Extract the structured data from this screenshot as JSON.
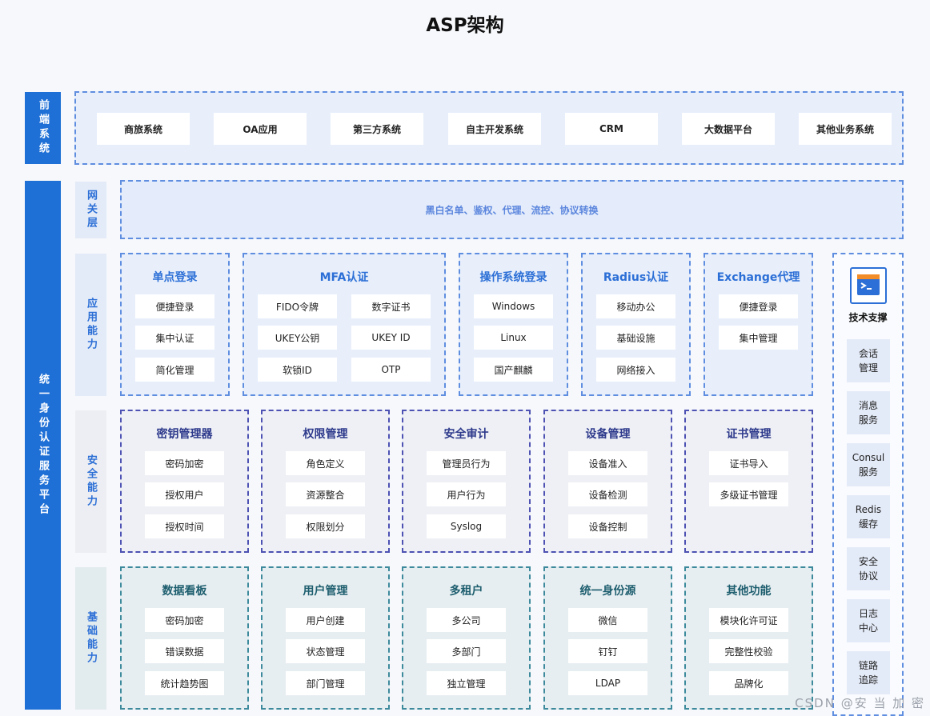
{
  "title": "ASP架构",
  "sidebar": {
    "front_label": "前端系统",
    "platform_label": "统一身份认证服务平台"
  },
  "front_systems": [
    "商旅系统",
    "OA应用",
    "第三方系统",
    "自主开发系统",
    "CRM",
    "大数据平台",
    "其他业务系统"
  ],
  "layers": {
    "gateway": "网关层",
    "application": "应用能力",
    "security": "安全能力",
    "foundation": "基础能力"
  },
  "gateway_text": "黑白名单、鉴权、代理、流控、协议转换",
  "application_modules": [
    {
      "title": "单点登录",
      "items": [
        "便捷登录",
        "集中认证",
        "简化管理"
      ]
    },
    {
      "title": "MFA认证",
      "items": [
        "FIDO令牌",
        "数字证书",
        "UKEY公钥",
        "UKEY ID",
        "软锁ID",
        "OTP"
      ]
    },
    {
      "title": "操作系统登录",
      "items": [
        "Windows",
        "Linux",
        "国产麒麟"
      ]
    },
    {
      "title": "Radius认证",
      "items": [
        "移动办公",
        "基础设施",
        "网络接入"
      ]
    },
    {
      "title": "Exchange代理",
      "items": [
        "便捷登录",
        "集中管理"
      ]
    }
  ],
  "security_modules": [
    {
      "title": "密钥管理器",
      "items": [
        "密码加密",
        "授权用户",
        "授权时间"
      ]
    },
    {
      "title": "权限管理",
      "items": [
        "角色定义",
        "资源整合",
        "权限划分"
      ]
    },
    {
      "title": "安全审计",
      "items": [
        "管理员行为",
        "用户行为",
        "Syslog"
      ]
    },
    {
      "title": "设备管理",
      "items": [
        "设备准入",
        "设备检测",
        "设备控制"
      ]
    },
    {
      "title": "证书管理",
      "items": [
        "证书导入",
        "多级证书管理"
      ]
    }
  ],
  "foundation_modules": [
    {
      "title": "数据看板",
      "items": [
        "密码加密",
        "错误数据",
        "统计趋势图"
      ]
    },
    {
      "title": "用户管理",
      "items": [
        "用户创建",
        "状态管理",
        "部门管理"
      ]
    },
    {
      "title": "多租户",
      "items": [
        "多公司",
        "多部门",
        "独立管理"
      ]
    },
    {
      "title": "统一身份源",
      "items": [
        "微信",
        "钉钉",
        "LDAP"
      ]
    },
    {
      "title": "其他功能",
      "items": [
        "模块化许可证",
        "完整性校验",
        "品牌化"
      ]
    }
  ],
  "tech_support": {
    "title": "技术支撑",
    "icon": "terminal-icon",
    "items": [
      "会话\n管理",
      "消息\n服务",
      "Consul\n服务",
      "Redis\n缓存",
      "安全\n协议",
      "日志\n中心",
      "链路\n追踪"
    ]
  },
  "watermark": "CSDN @安 当 加 密",
  "colors": {
    "primary": "#1e6fd6",
    "app_border": "#5f8ee0",
    "security_border": "#4d52b3",
    "foundation_border": "#3d8a9c"
  }
}
